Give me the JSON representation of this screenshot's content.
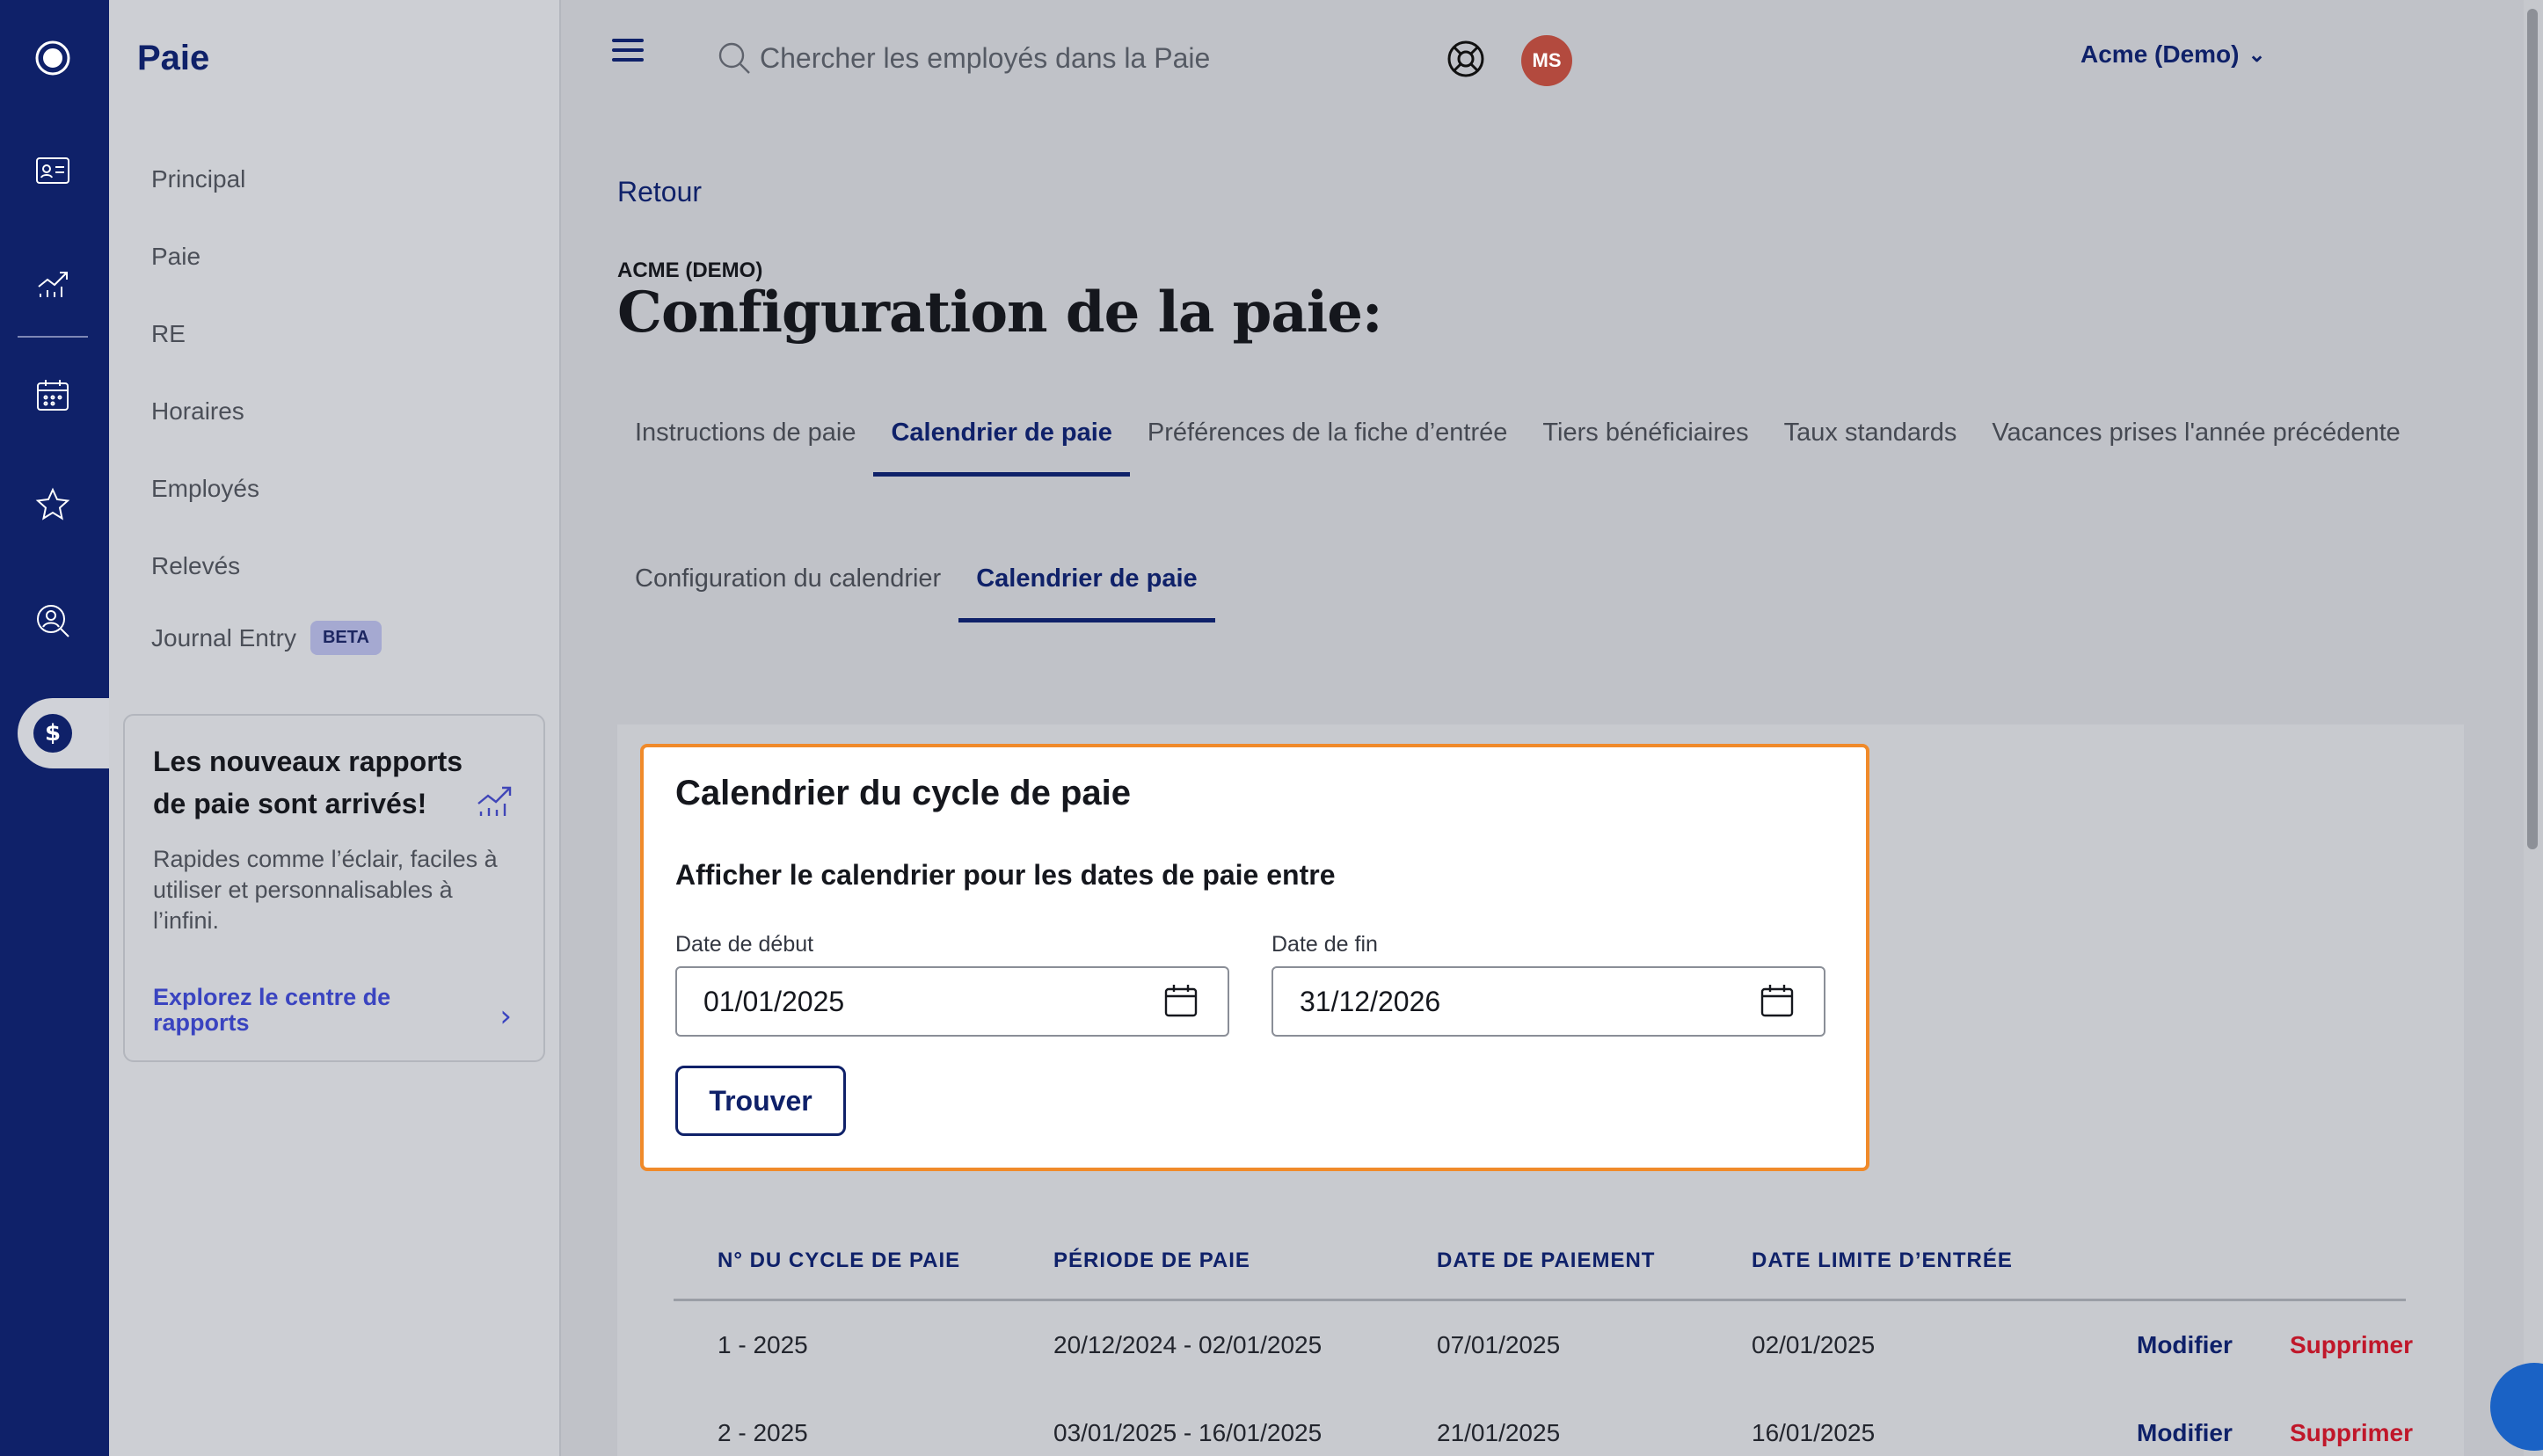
{
  "rail": {
    "icons": [
      "logo-icon",
      "employee-card-icon",
      "analytics-icon",
      "calendar-icon",
      "star-icon",
      "search-person-icon",
      "dollar-icon"
    ]
  },
  "sidebar": {
    "title": "Paie",
    "items": [
      {
        "label": "Principal"
      },
      {
        "label": "Paie"
      },
      {
        "label": "RE"
      },
      {
        "label": "Horaires"
      },
      {
        "label": "Employés"
      },
      {
        "label": "Relevés"
      },
      {
        "label": "Journal Entry",
        "badge": "BETA"
      }
    ],
    "promo": {
      "title": "Les nouveaux rapports de paie sont arrivés!",
      "description": "Rapides comme l’éclair, faciles à utiliser et personnalisables à l’infini.",
      "link": "Explorez le centre de rapports"
    }
  },
  "header": {
    "search_placeholder": "Chercher les employés dans la Paie",
    "company": "Acme (Demo)",
    "avatar_initials": "MS"
  },
  "page": {
    "back": "Retour",
    "company_caption": "ACME (DEMO)",
    "title": "Configuration de la paie:",
    "tabs": [
      {
        "label": "Instructions de paie",
        "active": false
      },
      {
        "label": "Calendrier de paie",
        "active": true
      },
      {
        "label": "Préférences de la fiche d’entrée",
        "active": false
      },
      {
        "label": "Tiers bénéficiaires",
        "active": false
      },
      {
        "label": "Taux standards",
        "active": false
      },
      {
        "label": "Vacances prises l'année précédente",
        "active": false
      }
    ],
    "subtabs": [
      {
        "label": "Configuration du calendrier",
        "active": false
      },
      {
        "label": "Calendrier de paie",
        "active": true
      }
    ]
  },
  "card": {
    "title": "Calendrier du cycle de paie",
    "subtitle": "Afficher le calendrier pour les dates de paie entre",
    "start_label": "Date de début",
    "start_value": "01/01/2025",
    "end_label": "Date de fin",
    "end_value": "31/12/2026",
    "find_button": "Trouver"
  },
  "table": {
    "headers": [
      "N° DU CYCLE DE PAIE",
      "PÉRIODE DE PAIE",
      "DATE DE PAIEMENT",
      "DATE LIMITE D’ENTRÉE"
    ],
    "edit_label": "Modifier",
    "delete_label": "Supprimer",
    "rows": [
      {
        "cycle": "1 - 2025",
        "period": "20/12/2024 - 02/01/2025",
        "payment": "07/01/2025",
        "deadline": "02/01/2025"
      },
      {
        "cycle": "2 - 2025",
        "period": "03/01/2025 - 16/01/2025",
        "payment": "21/01/2025",
        "deadline": "16/01/2025"
      }
    ]
  },
  "colors": {
    "navy": "#0f2169",
    "accent_orange": "#f08a2a",
    "delete_red": "#c0172a",
    "avatar_red": "#b34a3e"
  }
}
